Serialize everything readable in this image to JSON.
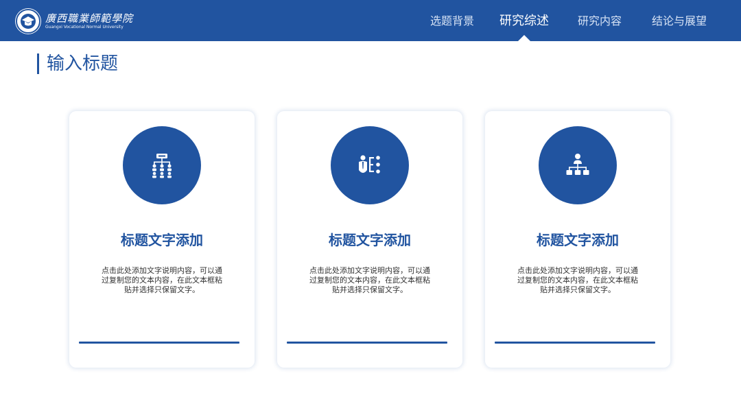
{
  "header": {
    "logo_cn": "廣西職業師範學院",
    "logo_en": "Guangxi Vocational Normal University",
    "nav": [
      {
        "label": "选题背景",
        "active": false
      },
      {
        "label": "研究综述",
        "active": true
      },
      {
        "label": "研究内容",
        "active": false
      },
      {
        "label": "结论与展望",
        "active": false
      }
    ]
  },
  "page": {
    "title": "输入标题"
  },
  "cards": [
    {
      "icon": "network-hierarchy-icon",
      "title": "标题文字添加",
      "desc": "点击此处添加文字说明内容，可以通过复制您的文本内容，在此文本框粘贴并选择只保留文字。"
    },
    {
      "icon": "person-list-icon",
      "title": "标题文字添加",
      "desc": "点击此处添加文字说明内容，可以通过复制您的文本内容，在此文本框粘贴并选择只保留文字。"
    },
    {
      "icon": "org-chart-icon",
      "title": "标题文字添加",
      "desc": "点击此处添加文字说明内容，可以通过复制您的文本内容，在此文本框粘贴并选择只保留文字。"
    }
  ],
  "colors": {
    "primary": "#2154a0",
    "nav_text": "#d7e3f5",
    "body_text": "#333333",
    "background": "#ffffff"
  }
}
